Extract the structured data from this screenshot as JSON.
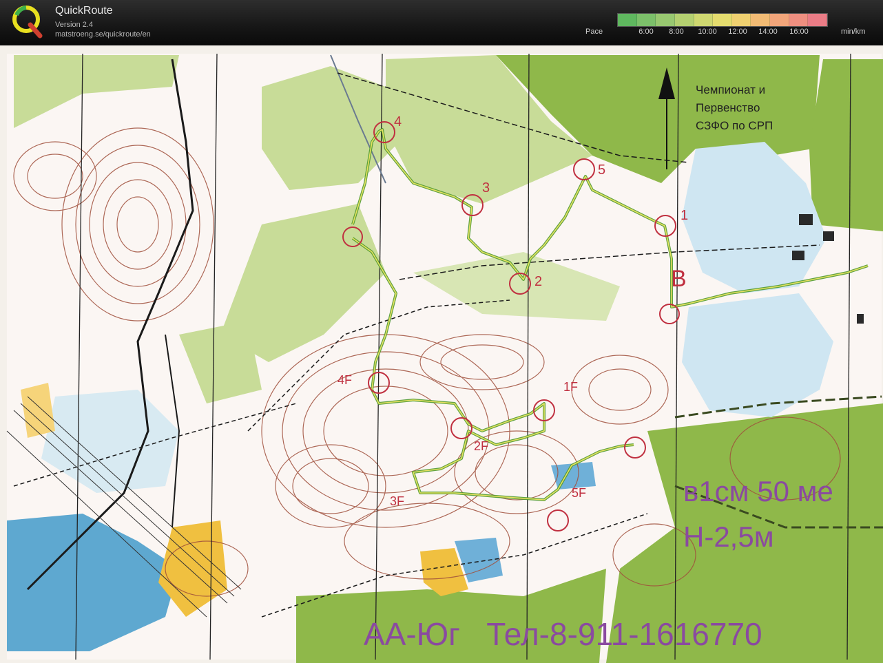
{
  "app": {
    "title": "QuickRoute",
    "version": "Version 2.4",
    "url": "matstroeng.se/quickroute/en"
  },
  "pace_legend": {
    "label": "Pace",
    "ticks": [
      "6:00",
      "8:00",
      "10:00",
      "12:00",
      "14:00",
      "16:00"
    ],
    "unit": "min/km",
    "colors": [
      "#5fb85f",
      "#7cc06a",
      "#98c870",
      "#b4d070",
      "#cfd870",
      "#e4dc6e",
      "#efd070",
      "#f2bb74",
      "#f2a57a",
      "#ef8f80",
      "#ea7c86"
    ]
  },
  "map": {
    "event_title_lines": [
      "Чемпионат и",
      "Первенство",
      "СЗФО по СРП"
    ],
    "scale_text": "в1см 50 ме",
    "contour_text": "Н-2,5м",
    "footer_text": "АА-Юг   Тел-8-911-1616770",
    "controls": [
      {
        "label": "1"
      },
      {
        "label": "2"
      },
      {
        "label": "3"
      },
      {
        "label": "4"
      },
      {
        "label": "5"
      }
    ],
    "finish_label": "B",
    "lower_course_labels": [
      "1F",
      "2F",
      "3F",
      "4F",
      "5F"
    ],
    "route_color": "#7fbf3f",
    "control_color": "#c03040"
  }
}
